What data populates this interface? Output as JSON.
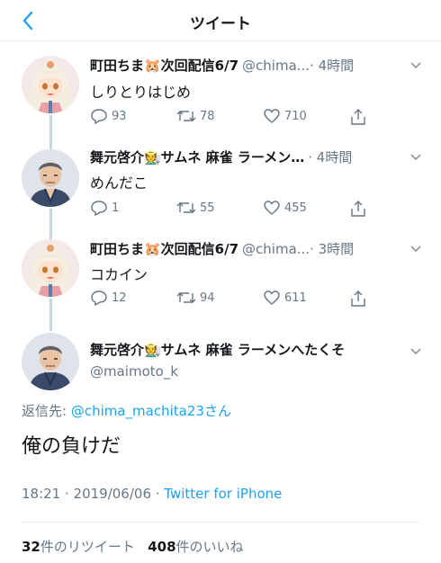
{
  "header": {
    "title": "ツイート",
    "back_icon": "chevron-left-icon"
  },
  "tweets": [
    {
      "display_name": "町田ちま🐹次回配信6/7",
      "handle": "@chima...",
      "time": "· 4時間",
      "text": "しりとりはじめ",
      "replies": "93",
      "retweets": "78",
      "likes": "710"
    },
    {
      "display_name": "舞元啓介🧑‍🌾サムネ 麻雀 ラーメン…",
      "handle": "",
      "time": "· 4時間",
      "text": "めんだこ",
      "replies": "1",
      "retweets": "55",
      "likes": "455"
    },
    {
      "display_name": "町田ちま🐹次回配信6/7",
      "handle": "@chima...",
      "time": "· 3時間",
      "text": "コカイン",
      "replies": "12",
      "retweets": "94",
      "likes": "611"
    }
  ],
  "main_tweet": {
    "display_name": "舞元啓介🧑‍🌾サムネ 麻雀 ラーメンへたくそ",
    "handle": "@maimoto_k",
    "reply_prefix": "返信先: ",
    "reply_mention": "@chima_machita23",
    "reply_suffix": "さん",
    "text": "俺の負けだ",
    "timestamp": "18:21 · 2019/06/06 · ",
    "source": "Twitter for iPhone",
    "retweet_count": "32",
    "retweet_label": "件のリツイート",
    "like_count": "408",
    "like_label": "件のいいね"
  },
  "colors": {
    "accent": "#1da1f2",
    "muted": "#657786",
    "text": "#14171a"
  }
}
